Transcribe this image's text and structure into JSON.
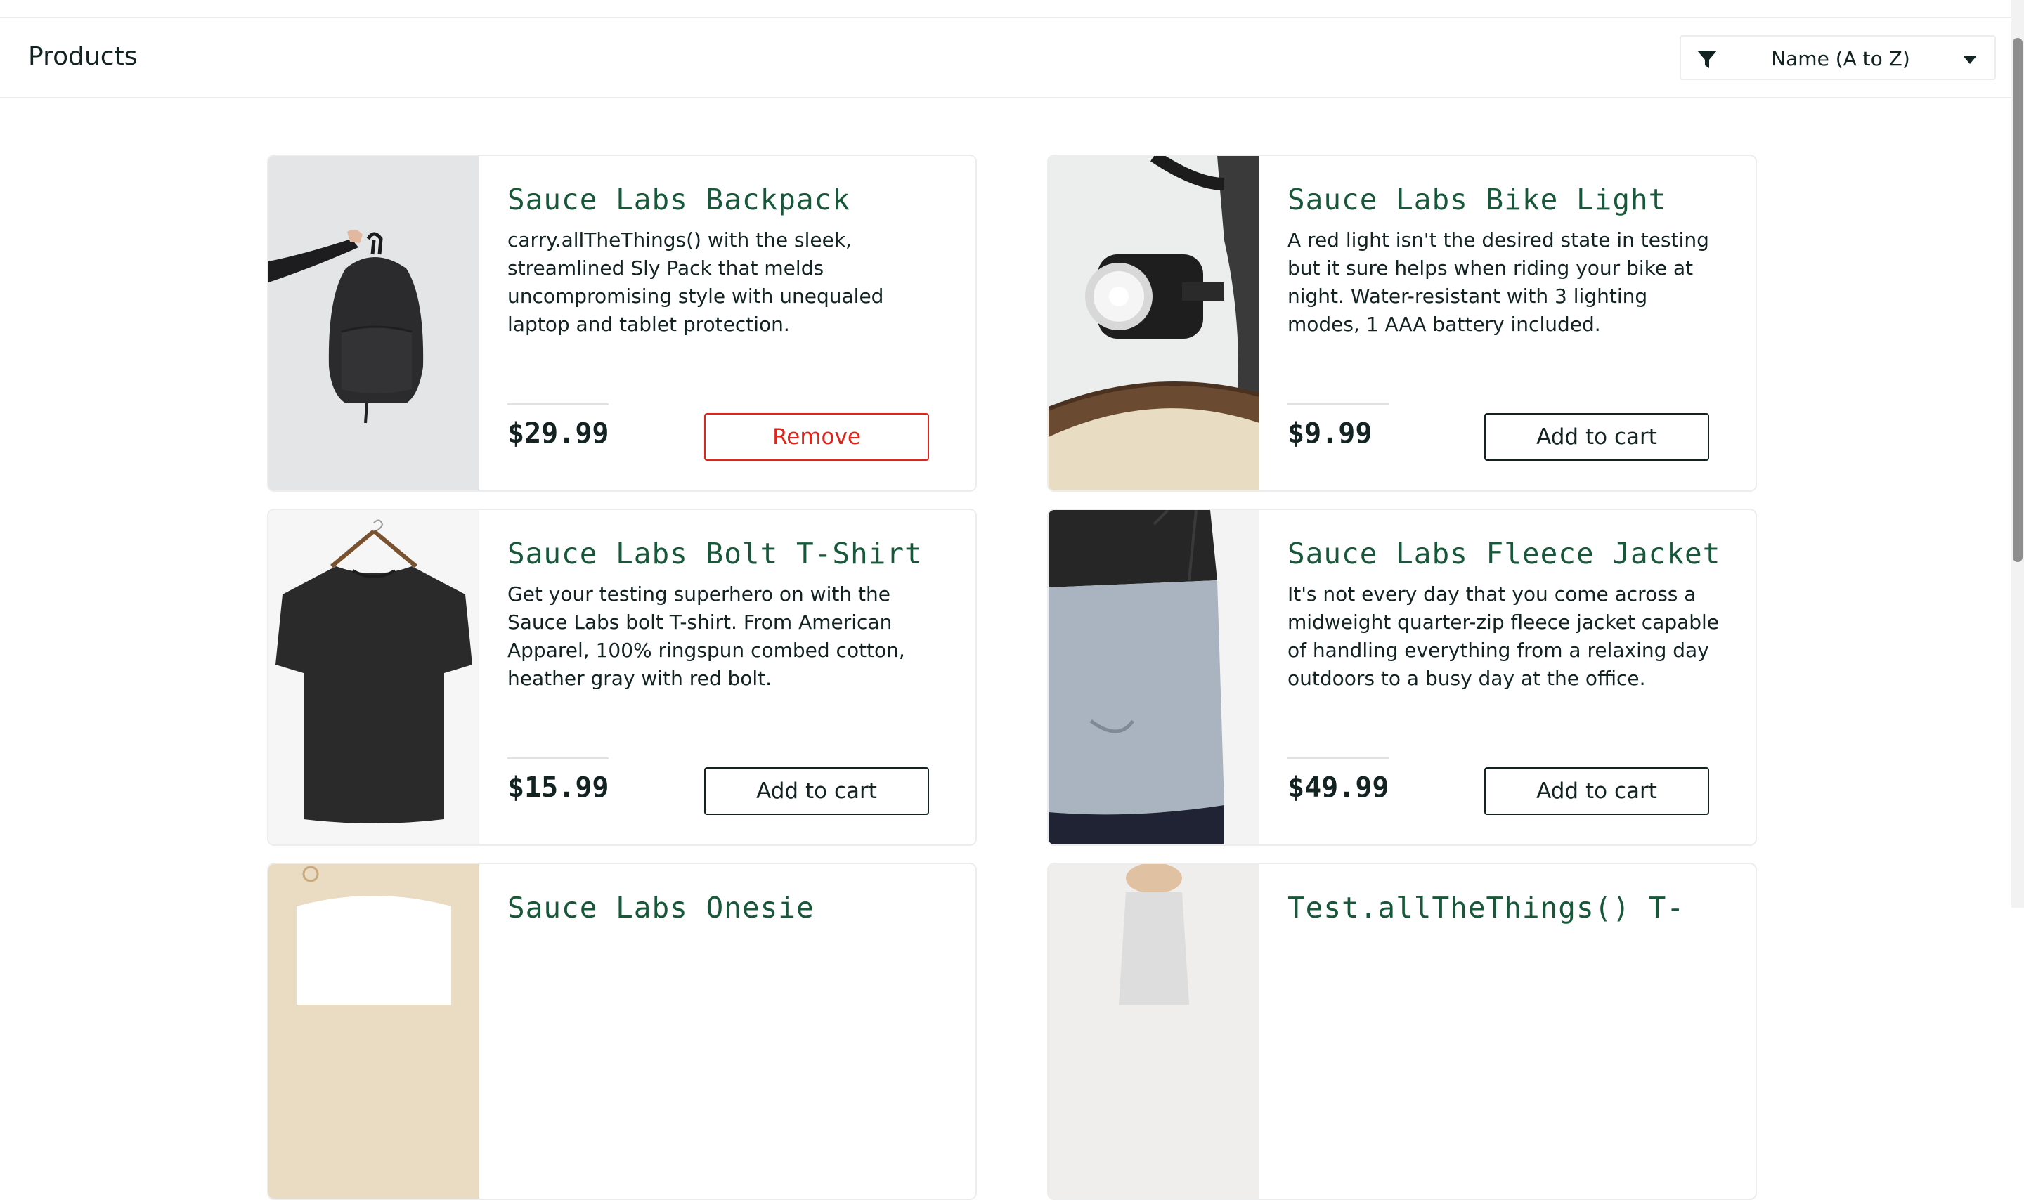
{
  "header": {
    "title": "Products",
    "sort": {
      "selected": "Name (A to Z)",
      "filter_icon": "filter-icon",
      "caret_icon": "caret-down-icon"
    }
  },
  "colors": {
    "name": "#18583a",
    "text": "#132322",
    "remove": "#e2231a",
    "border": "#ededed"
  },
  "products": [
    {
      "name": "Sauce Labs Backpack",
      "description": "carry.allTheThings() with the sleek, streamlined Sly Pack that melds uncompromising style with unequaled laptop and tablet protection.",
      "price": "$29.99",
      "button": "Remove",
      "image": "backpack-image"
    },
    {
      "name": "Sauce Labs Bike Light",
      "description": "A red light isn't the desired state in testing but it sure helps when riding your bike at night. Water-resistant with 3 lighting modes, 1 AAA battery included.",
      "price": "$9.99",
      "button": "Add to cart",
      "image": "bike-light-image"
    },
    {
      "name": "Sauce Labs Bolt T-Shirt",
      "description": "Get your testing superhero on with the Sauce Labs bolt T-shirt. From American Apparel, 100% ringspun combed cotton, heather gray with red bolt.",
      "price": "$15.99",
      "button": "Add to cart",
      "image": "tshirt-image"
    },
    {
      "name": "Sauce Labs Fleece Jacket",
      "description": "It's not every day that you come across a midweight quarter-zip fleece jacket capable of handling everything from a relaxing day outdoors to a busy day at the office.",
      "price": "$49.99",
      "button": "Add to cart",
      "image": "fleece-jacket-image"
    },
    {
      "name": "Sauce Labs Onesie",
      "image": "onesie-image"
    },
    {
      "name": "Test.allTheThings() T-",
      "image": "test-tshirt-image"
    }
  ]
}
